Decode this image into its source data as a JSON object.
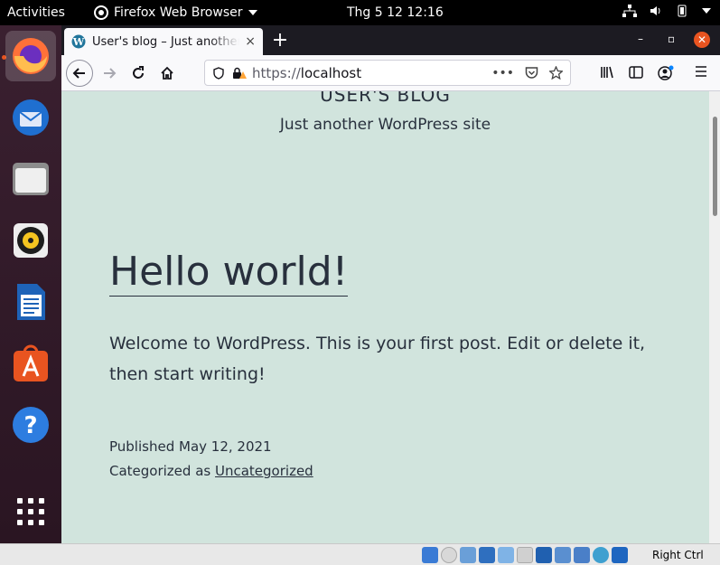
{
  "topbar": {
    "activities": "Activities",
    "app_name": "Firefox Web Browser",
    "clock": "Thg 5 12  12:16"
  },
  "dock": {
    "items": [
      {
        "name": "firefox-icon"
      },
      {
        "name": "thunderbird-icon"
      },
      {
        "name": "files-icon"
      },
      {
        "name": "rhythmbox-icon"
      },
      {
        "name": "libreoffice-writer-icon"
      },
      {
        "name": "software-center-icon"
      },
      {
        "name": "help-icon"
      },
      {
        "name": "show-apps-icon"
      }
    ]
  },
  "browser": {
    "tab_title": "User's blog – Just another WordPress site",
    "tab_close": "×",
    "new_tab": "+",
    "url_prefix": "https://",
    "url_host": "localhost"
  },
  "page": {
    "site_title": "USER'S BLOG",
    "site_description": "Just another WordPress site",
    "post_title": "Hello world!",
    "post_body": "Welcome to WordPress. This is your first post. Edit or delete it, then start writing!",
    "published_label": "Published",
    "published_date": "May 12, 2021",
    "category_label": "Categorized as",
    "category": "Uncategorized"
  },
  "vbox": {
    "host_key": "Right Ctrl"
  },
  "colors": {
    "page_bg": "#d1e4dd",
    "text": "#28303d",
    "accent": "#e95420"
  }
}
